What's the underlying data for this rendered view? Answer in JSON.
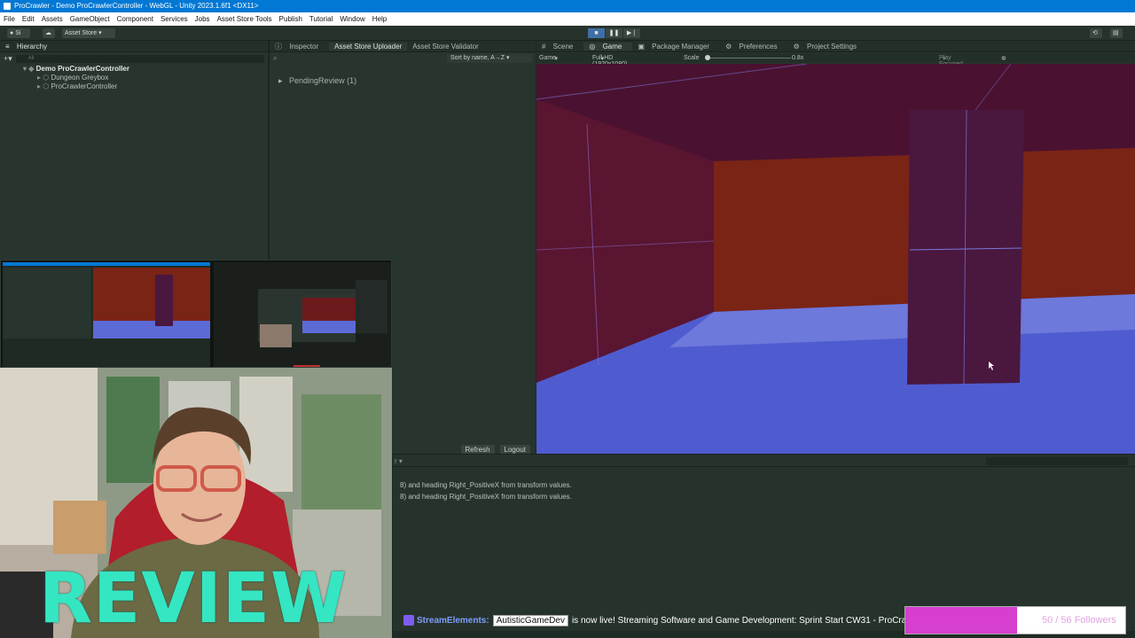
{
  "window": {
    "title": "ProCrawler - Demo ProCrawlerController - WebGL - Unity 2023.1.6f1 <DX11>"
  },
  "menu": [
    "File",
    "Edit",
    "Assets",
    "GameObject",
    "Component",
    "Services",
    "Jobs",
    "Asset Store Tools",
    "Publish",
    "Tutorial",
    "Window",
    "Help"
  ],
  "toolbar": {
    "account": "Si",
    "asset_store": "Asset Store"
  },
  "hierarchy": {
    "tab": "Hierarchy",
    "search_placeholder": "All",
    "scene": "Demo ProCrawlerController",
    "children": [
      "Dungeon Greybox",
      "ProCrawlerController"
    ]
  },
  "inspector": {
    "tabs": [
      "Inspector",
      "Asset Store Uploader",
      "Asset Store Validator"
    ],
    "sort": "Sort by name, A→Z",
    "pending": "PendingReview (1)",
    "refresh": "Refresh",
    "logout": "Logout"
  },
  "game": {
    "tabs": [
      "Scene",
      "Game",
      "Package Manager",
      "Preferences",
      "Project Settings"
    ],
    "display": "Game",
    "resolution": "Full HD (1920x1080)",
    "scale_label": "Scale",
    "scale_value": "0.8x",
    "play_mode": "Play Focused",
    "scale_fraction": 0
  },
  "console": {
    "lines": [
      "8) and heading Right_PositiveX from transform values.",
      "8) and heading Right_PositiveX from transform values."
    ]
  },
  "overlay": {
    "review": "REVIEW",
    "ticker_source": "StreamElements:",
    "ticker_user": "AutisticGameDev",
    "ticker_message": "is now live! Streaming Software and Game Development: Sprint Start CW31 - ProCrawler: First-Person Dungeon Crawler for Unity",
    "followers": "50 / 56 Followers",
    "followers_fraction": 0.893
  },
  "colors": {
    "accent": "#0078d4",
    "review": "#35e6c3",
    "follower_bar": "#d63fcf"
  }
}
